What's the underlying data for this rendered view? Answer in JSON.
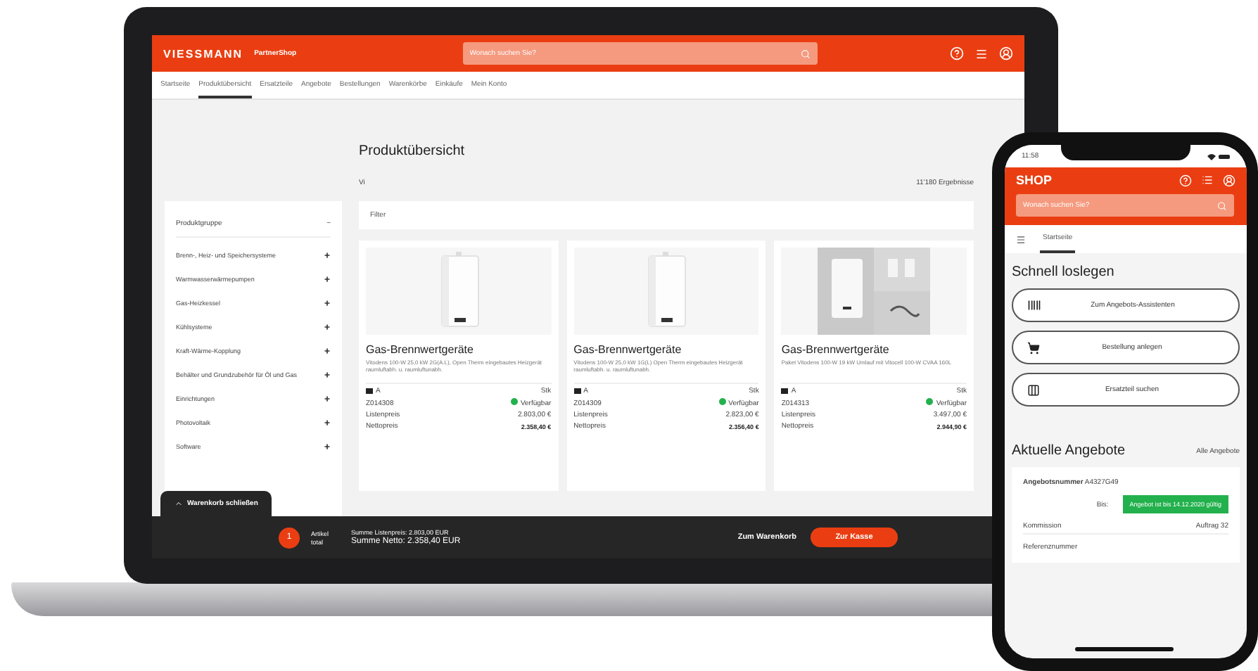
{
  "laptop": {
    "header": {
      "logo": "VIESSMANN",
      "logo_suffix": "PartnerShop",
      "search": {
        "placeholder": "Wonach suchen Sie?"
      }
    },
    "nav": [
      {
        "label": "Startseite",
        "selected": false
      },
      {
        "label": "Produktübersicht",
        "selected": true
      },
      {
        "label": "Ersatzteile",
        "selected": false
      },
      {
        "label": "Angebote",
        "selected": false
      },
      {
        "label": "Bestellungen",
        "selected": false
      },
      {
        "label": "Warenkörbe",
        "selected": false
      },
      {
        "label": "Einkäufe",
        "selected": false
      },
      {
        "label": "Mein Konto",
        "selected": false
      }
    ],
    "title": "Produktübersicht",
    "breadcrumb": "Vi",
    "result_count": "11'180 Ergebnisse",
    "sidebar": {
      "title": "Produktgruppe",
      "toggle": "−",
      "items": [
        {
          "label": "Brenn-, Heiz- und Speichersysteme"
        },
        {
          "label": "Warmwasserwärmepumpen"
        },
        {
          "label": "Gas-Heizkessel"
        },
        {
          "label": "Kühlsysteme"
        },
        {
          "label": "Kraft-Wärme-Kopplung"
        },
        {
          "label": "Behälter und Grundzubehör für Öl und Gas"
        },
        {
          "label": "Einrichtungen"
        },
        {
          "label": "Photovoltaik"
        },
        {
          "label": "Software"
        }
      ]
    },
    "filter": {
      "placeholder": "Filter"
    },
    "products": [
      {
        "title": "Gas-Brennwertgeräte",
        "description": "Vitodens 100-W 25,0 kW 2G(A.L), Open Therm eingebautes Heizgerät raumluftabh. u. raumluftunabh.",
        "energy": "A",
        "unit": "Stk",
        "sku": "Z014308",
        "available": true,
        "availability": "Verfügbar",
        "list_label": "Listenpreis",
        "list_price": "2.803,00 €",
        "net_label": "Nettopreis",
        "net_price": "2.358,40 €",
        "kind": "boiler"
      },
      {
        "title": "Gas-Brennwertgeräte",
        "description": "Vitodens 100-W 25,0 kW 1G(L) Open Therm eingebautes Heizgerät raumluftabh. u. raumluftunabh.",
        "energy": "A",
        "unit": "Stk",
        "sku": "Z014309",
        "available": true,
        "availability": "Verfügbar",
        "list_label": "Listenpreis",
        "list_price": "2.823,00 €",
        "net_label": "Nettopreis",
        "net_price": "2.356,40 €",
        "kind": "boiler"
      },
      {
        "title": "Gas-Brennwertgeräte",
        "description": "Paket Vitodens 100-W 19 kW Umlauf mit Vitocell 100-W CVAA 160L",
        "energy": "A",
        "unit": "Stk",
        "sku": "Z014313",
        "available": true,
        "availability": "Verfügbar",
        "list_label": "Listenpreis",
        "list_price": "3.497,00 €",
        "net_label": "Nettopreis",
        "net_price": "2.944,90 €",
        "kind": "package"
      }
    ],
    "cart": {
      "toggle": "Warenkorb schließen",
      "count": "1",
      "count_label": "Artikel",
      "count_sub": "total",
      "list_sum": "Summe Listenpreis: 2.803,00 EUR",
      "net_sum": "Summe Netto: 2.358,40 EUR",
      "cart_button": "Zum Warenkorb",
      "checkout_button": "Zur Kasse"
    }
  },
  "phone": {
    "time": "11:58",
    "logo": "SHOP",
    "search": {
      "placeholder": "Wonach suchen Sie?"
    },
    "tab": {
      "label": "Startseite",
      "selected": true
    },
    "quick_title": "Schnell loslegen",
    "actions": [
      {
        "label": "Zum Angebots-Assistenten",
        "kind": "barcode"
      },
      {
        "label": "Bestellung anlegen",
        "kind": "cart"
      },
      {
        "label": "Ersatzteil suchen",
        "kind": "parts"
      }
    ],
    "offers_title": "Aktuelle Angebote",
    "offers_link": "Alle Angebote",
    "offer": {
      "number_label": "Angebotsnummer",
      "number": "A4327G49",
      "until_label": "Bis:",
      "validity": "Angebot ist bis 14.12.2020 gültig",
      "commission_label": "Kommission",
      "commission": "Auftrag 32",
      "reference": "Referenznummer"
    }
  }
}
